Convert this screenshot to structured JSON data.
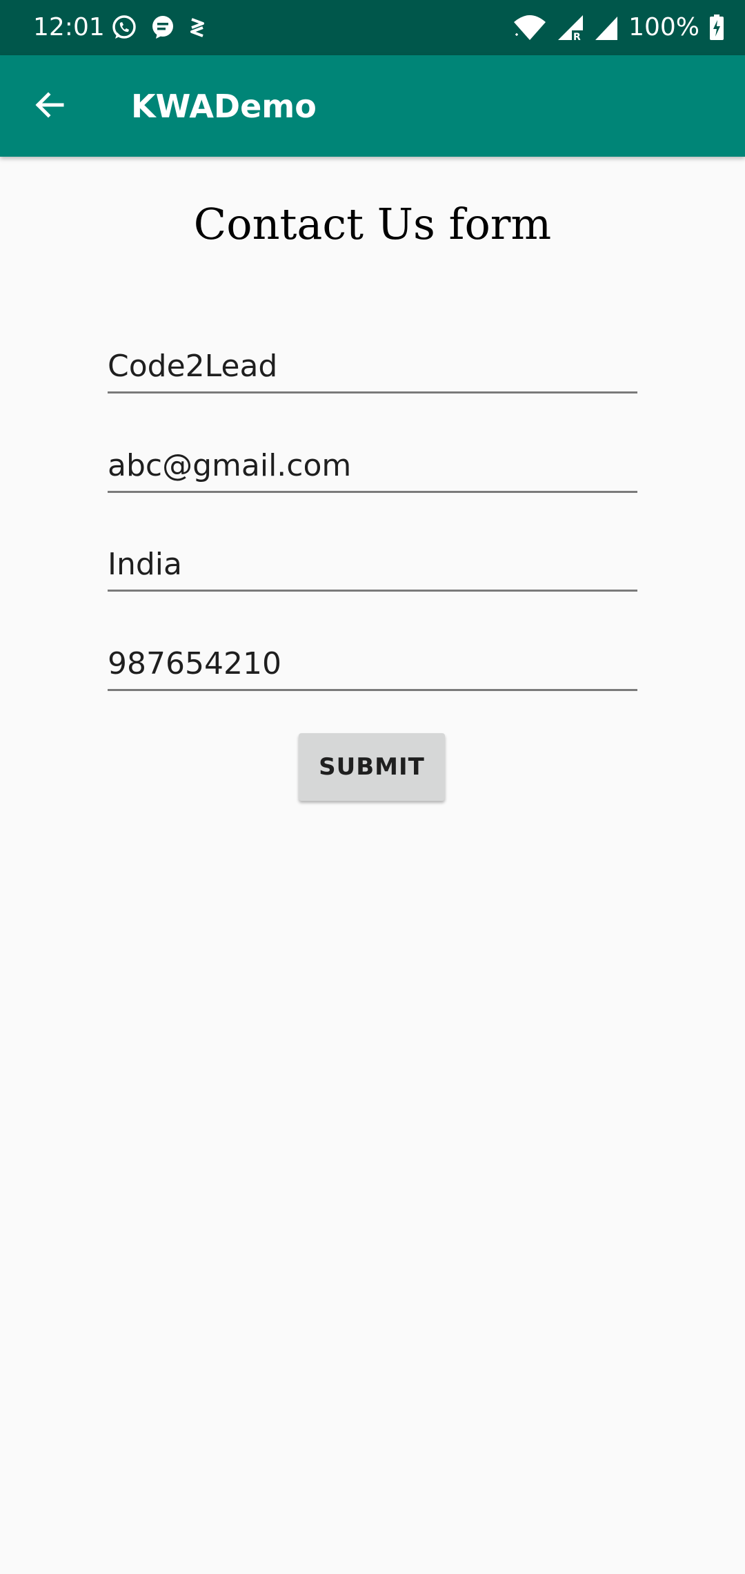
{
  "status_bar": {
    "time": "12:01",
    "battery_text": "100%",
    "icons": [
      "whatsapp-icon",
      "message-icon",
      "app-notification-icon",
      "wifi-icon",
      "signal-roaming-icon",
      "signal-icon",
      "battery-charging-icon"
    ]
  },
  "app_bar": {
    "title": "KWADemo",
    "back_icon": "arrow-back-icon",
    "color": "#008577",
    "status_color": "#00574b"
  },
  "form": {
    "title": "Contact Us form",
    "fields": {
      "name": {
        "value": "Code2Lead"
      },
      "email": {
        "value": "abc@gmail.com"
      },
      "country": {
        "value": "India"
      },
      "phone": {
        "value": "987654210"
      }
    },
    "submit_label": "SUBMIT"
  }
}
